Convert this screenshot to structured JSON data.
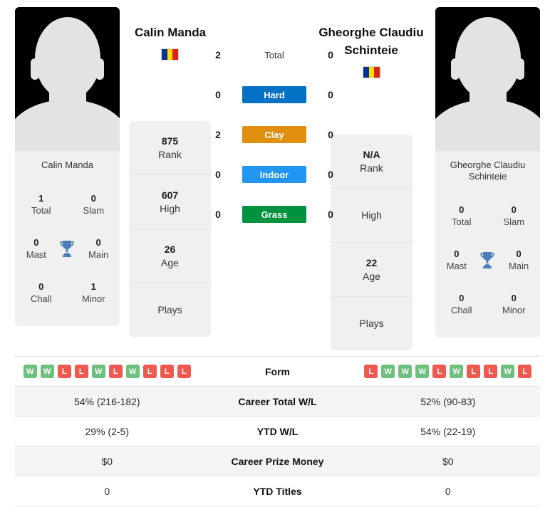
{
  "players": {
    "left": {
      "name": "Calin Manda",
      "card_name": "Calin Manda",
      "flag": "romania-flag",
      "titles": {
        "total_value": "1",
        "total_label": "Total",
        "slam_value": "0",
        "slam_label": "Slam",
        "mast_value": "0",
        "mast_label": "Mast",
        "main_value": "0",
        "main_label": "Main",
        "chall_value": "0",
        "chall_label": "Chall",
        "minor_value": "1",
        "minor_label": "Minor"
      },
      "stats": {
        "rank_value": "875",
        "rank_label": "Rank",
        "high_value": "607",
        "high_label": "High",
        "age_value": "26",
        "age_label": "Age",
        "plays_value": "",
        "plays_label": "Plays"
      },
      "form": [
        "W",
        "W",
        "L",
        "L",
        "W",
        "L",
        "W",
        "L",
        "L",
        "L"
      ],
      "career_wl": "54% (216-182)",
      "ytd_wl": "29% (2-5)",
      "career_prize": "$0",
      "ytd_titles": "0"
    },
    "right": {
      "name": "Gheorghe Claudiu Schinteie",
      "card_name": "Gheorghe Claudiu Schinteie",
      "flag": "romania-flag",
      "titles": {
        "total_value": "0",
        "total_label": "Total",
        "slam_value": "0",
        "slam_label": "Slam",
        "mast_value": "0",
        "mast_label": "Mast",
        "main_value": "0",
        "main_label": "Main",
        "chall_value": "0",
        "chall_label": "Chall",
        "minor_value": "0",
        "minor_label": "Minor"
      },
      "stats": {
        "rank_value": "N/A",
        "rank_label": "Rank",
        "high_value": "",
        "high_label": "High",
        "age_value": "22",
        "age_label": "Age",
        "plays_value": "",
        "plays_label": "Plays"
      },
      "form": [
        "L",
        "W",
        "W",
        "W",
        "L",
        "W",
        "L",
        "L",
        "W",
        "L"
      ],
      "career_wl": "52% (90-83)",
      "ytd_wl": "54% (22-19)",
      "career_prize": "$0",
      "ytd_titles": "0"
    }
  },
  "head_to_head": {
    "rows": [
      {
        "label": "Total",
        "left": "2",
        "right": "0",
        "color": "transparent"
      },
      {
        "label": "Hard",
        "left": "0",
        "right": "0",
        "color": "#0571c4"
      },
      {
        "label": "Clay",
        "left": "2",
        "right": "0",
        "color": "#e0900d"
      },
      {
        "label": "Indoor",
        "left": "0",
        "right": "0",
        "color": "#2196f3"
      },
      {
        "label": "Grass",
        "left": "0",
        "right": "0",
        "color": "#00933f"
      }
    ]
  },
  "table": {
    "form_label": "Form",
    "career_total_wl_label": "Career Total W/L",
    "ytd_wl_label": "YTD W/L",
    "career_prize_label": "Career Prize Money",
    "ytd_titles_label": "YTD Titles"
  },
  "colors": {
    "win": "#6ec07f",
    "loss": "#f0594f",
    "trophy": "#4a7ebb",
    "panel": "#f0f0f0"
  }
}
